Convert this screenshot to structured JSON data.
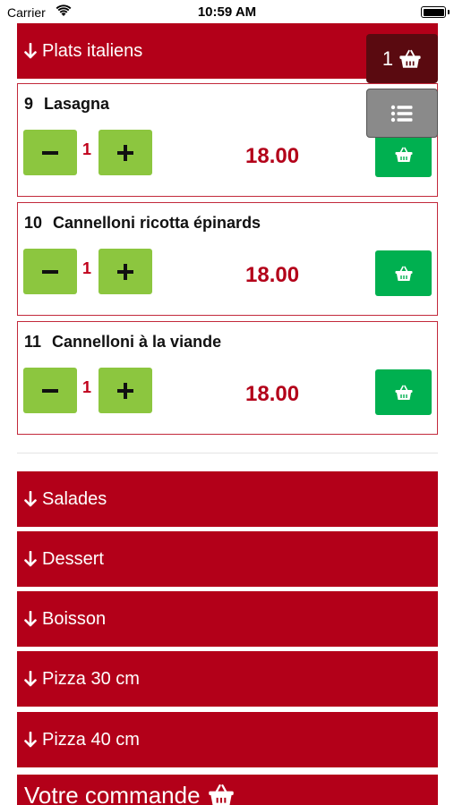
{
  "status_bar": {
    "carrier": "Carrier",
    "time": "10:59 AM"
  },
  "colors": {
    "brand_red": "#b30019",
    "qty_green": "#8cc63f",
    "cart_green": "#00b050",
    "cart_badge": "#5a0a10",
    "menu_gray": "#8a8a8a"
  },
  "sections": {
    "top": {
      "label": "Plats italiens",
      "icon": "arrow-down-icon"
    },
    "collapsed": [
      {
        "label": "Salades",
        "icon": "arrow-down-icon"
      },
      {
        "label": "Dessert",
        "icon": "arrow-down-icon"
      },
      {
        "label": "Boisson",
        "icon": "arrow-down-icon"
      },
      {
        "label": "Pizza 30 cm",
        "icon": "arrow-down-icon"
      },
      {
        "label": "Pizza 40 cm",
        "icon": "arrow-down-icon"
      }
    ]
  },
  "items": [
    {
      "number": "9",
      "name": "Lasagna",
      "qty": "1",
      "price": "18.00"
    },
    {
      "number": "10",
      "name": "Cannelloni ricotta épinards",
      "qty": "1",
      "price": "18.00"
    },
    {
      "number": "11",
      "name": "Cannelloni à la viande",
      "qty": "1",
      "price": "18.00"
    }
  ],
  "floating": {
    "cart_count": "1",
    "cart_icon": "basket-icon",
    "menu_icon": "list-icon"
  },
  "order_bar": {
    "label": "Votre commande",
    "icon": "basket-icon"
  }
}
